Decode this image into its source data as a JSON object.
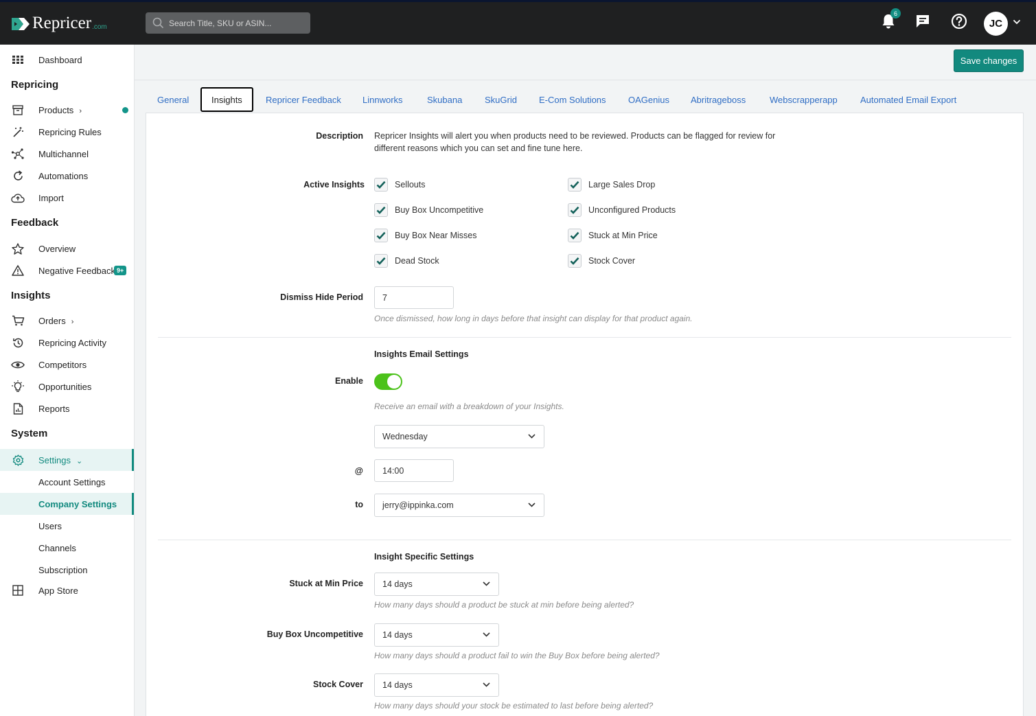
{
  "app": {
    "logo_text": "Repricer",
    "logo_suffix": ".com",
    "search_placeholder": "Search Title, SKU or ASIN...",
    "notifications_count": "6",
    "user_initials": "JC"
  },
  "sidebar": {
    "dashboard": "Dashboard",
    "sections": {
      "repricing": "Repricing",
      "feedback": "Feedback",
      "insights": "Insights",
      "system": "System"
    },
    "items": {
      "products": "Products",
      "repricing_rules": "Repricing Rules",
      "multichannel": "Multichannel",
      "automations": "Automations",
      "import": "Import",
      "overview": "Overview",
      "negative_feedback": "Negative Feedback",
      "negative_feedback_badge": "9+",
      "orders": "Orders",
      "repricing_activity": "Repricing Activity",
      "competitors": "Competitors",
      "opportunities": "Opportunities",
      "reports": "Reports",
      "settings": "Settings",
      "account_settings": "Account Settings",
      "company_settings": "Company Settings",
      "users": "Users",
      "channels": "Channels",
      "subscription": "Subscription",
      "app_store": "App Store"
    }
  },
  "toolbar": {
    "save_label": "Save changes"
  },
  "tabs": [
    "General",
    "Insights",
    "Repricer Feedback",
    "Linnworks",
    "Skubana",
    "SkuGrid",
    "E-Com Solutions",
    "OAGenius",
    "Abritrageboss",
    "Webscrapperapp",
    "Automated Email Export"
  ],
  "active_tab": "Insights",
  "form": {
    "description_label": "Description",
    "description_line1": "Repricer Insights will alert you when products need to be reviewed. Products can be flagged for review for",
    "description_line2": "different reasons which you can set and fine tune here.",
    "active_insights_label": "Active Insights",
    "insights": [
      {
        "label": "Sellouts",
        "checked": true
      },
      {
        "label": "Large Sales Drop",
        "checked": true
      },
      {
        "label": "Buy Box Uncompetitive",
        "checked": true
      },
      {
        "label": "Unconfigured Products",
        "checked": true
      },
      {
        "label": "Buy Box Near Misses",
        "checked": true
      },
      {
        "label": "Stuck at Min Price",
        "checked": true
      },
      {
        "label": "Dead Stock",
        "checked": true
      },
      {
        "label": "Stock Cover",
        "checked": true
      }
    ],
    "dismiss_label": "Dismiss Hide Period",
    "dismiss_value": "7",
    "dismiss_hint": "Once dismissed, how long in days before that insight can display for that product again.",
    "email_section_title": "Insights Email Settings",
    "enable_label": "Enable",
    "enable_on": true,
    "enable_hint": "Receive an email with a breakdown of your Insights.",
    "day_value": "Wednesday",
    "at_label": "@",
    "time_value": "14:00",
    "to_label": "to",
    "email_value": "jerry@ippinka.com",
    "specific_section_title": "Insight Specific Settings",
    "stuck_label": "Stuck at Min Price",
    "stuck_value": "14 days",
    "stuck_hint": "How many days should a product be stuck at min before being alerted?",
    "buybox_label": "Buy Box Uncompetitive",
    "buybox_value": "14 days",
    "buybox_hint": "How many days should a product fail to win the Buy Box before being alerted?",
    "stockcover_label": "Stock Cover",
    "stockcover_value": "14 days",
    "stockcover_hint": "How many days should your stock be estimated to last before being alerted?"
  },
  "colors": {
    "accent": "#12897e",
    "topbar": "#1f2021",
    "link": "#2f6dc4",
    "toggle_on": "#4cc21b"
  }
}
